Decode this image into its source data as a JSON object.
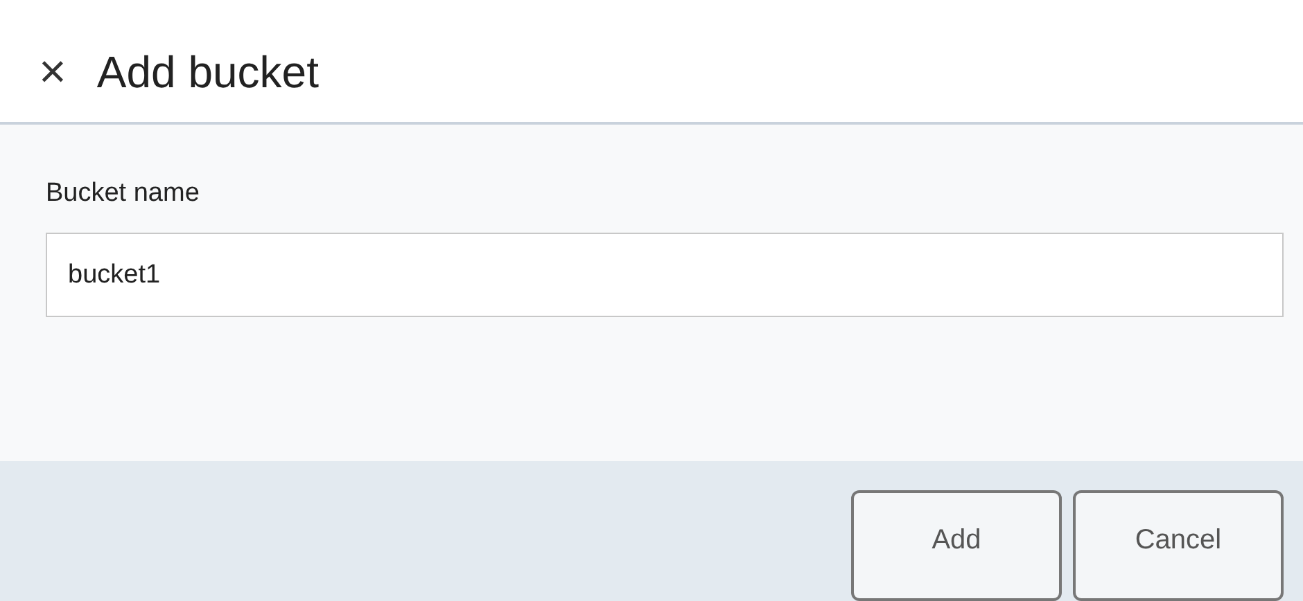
{
  "dialog": {
    "close_icon": "×",
    "title": "Add bucket"
  },
  "form": {
    "label": "Bucket name",
    "value": "bucket1"
  },
  "buttons": [
    "Add",
    "Cancel"
  ]
}
